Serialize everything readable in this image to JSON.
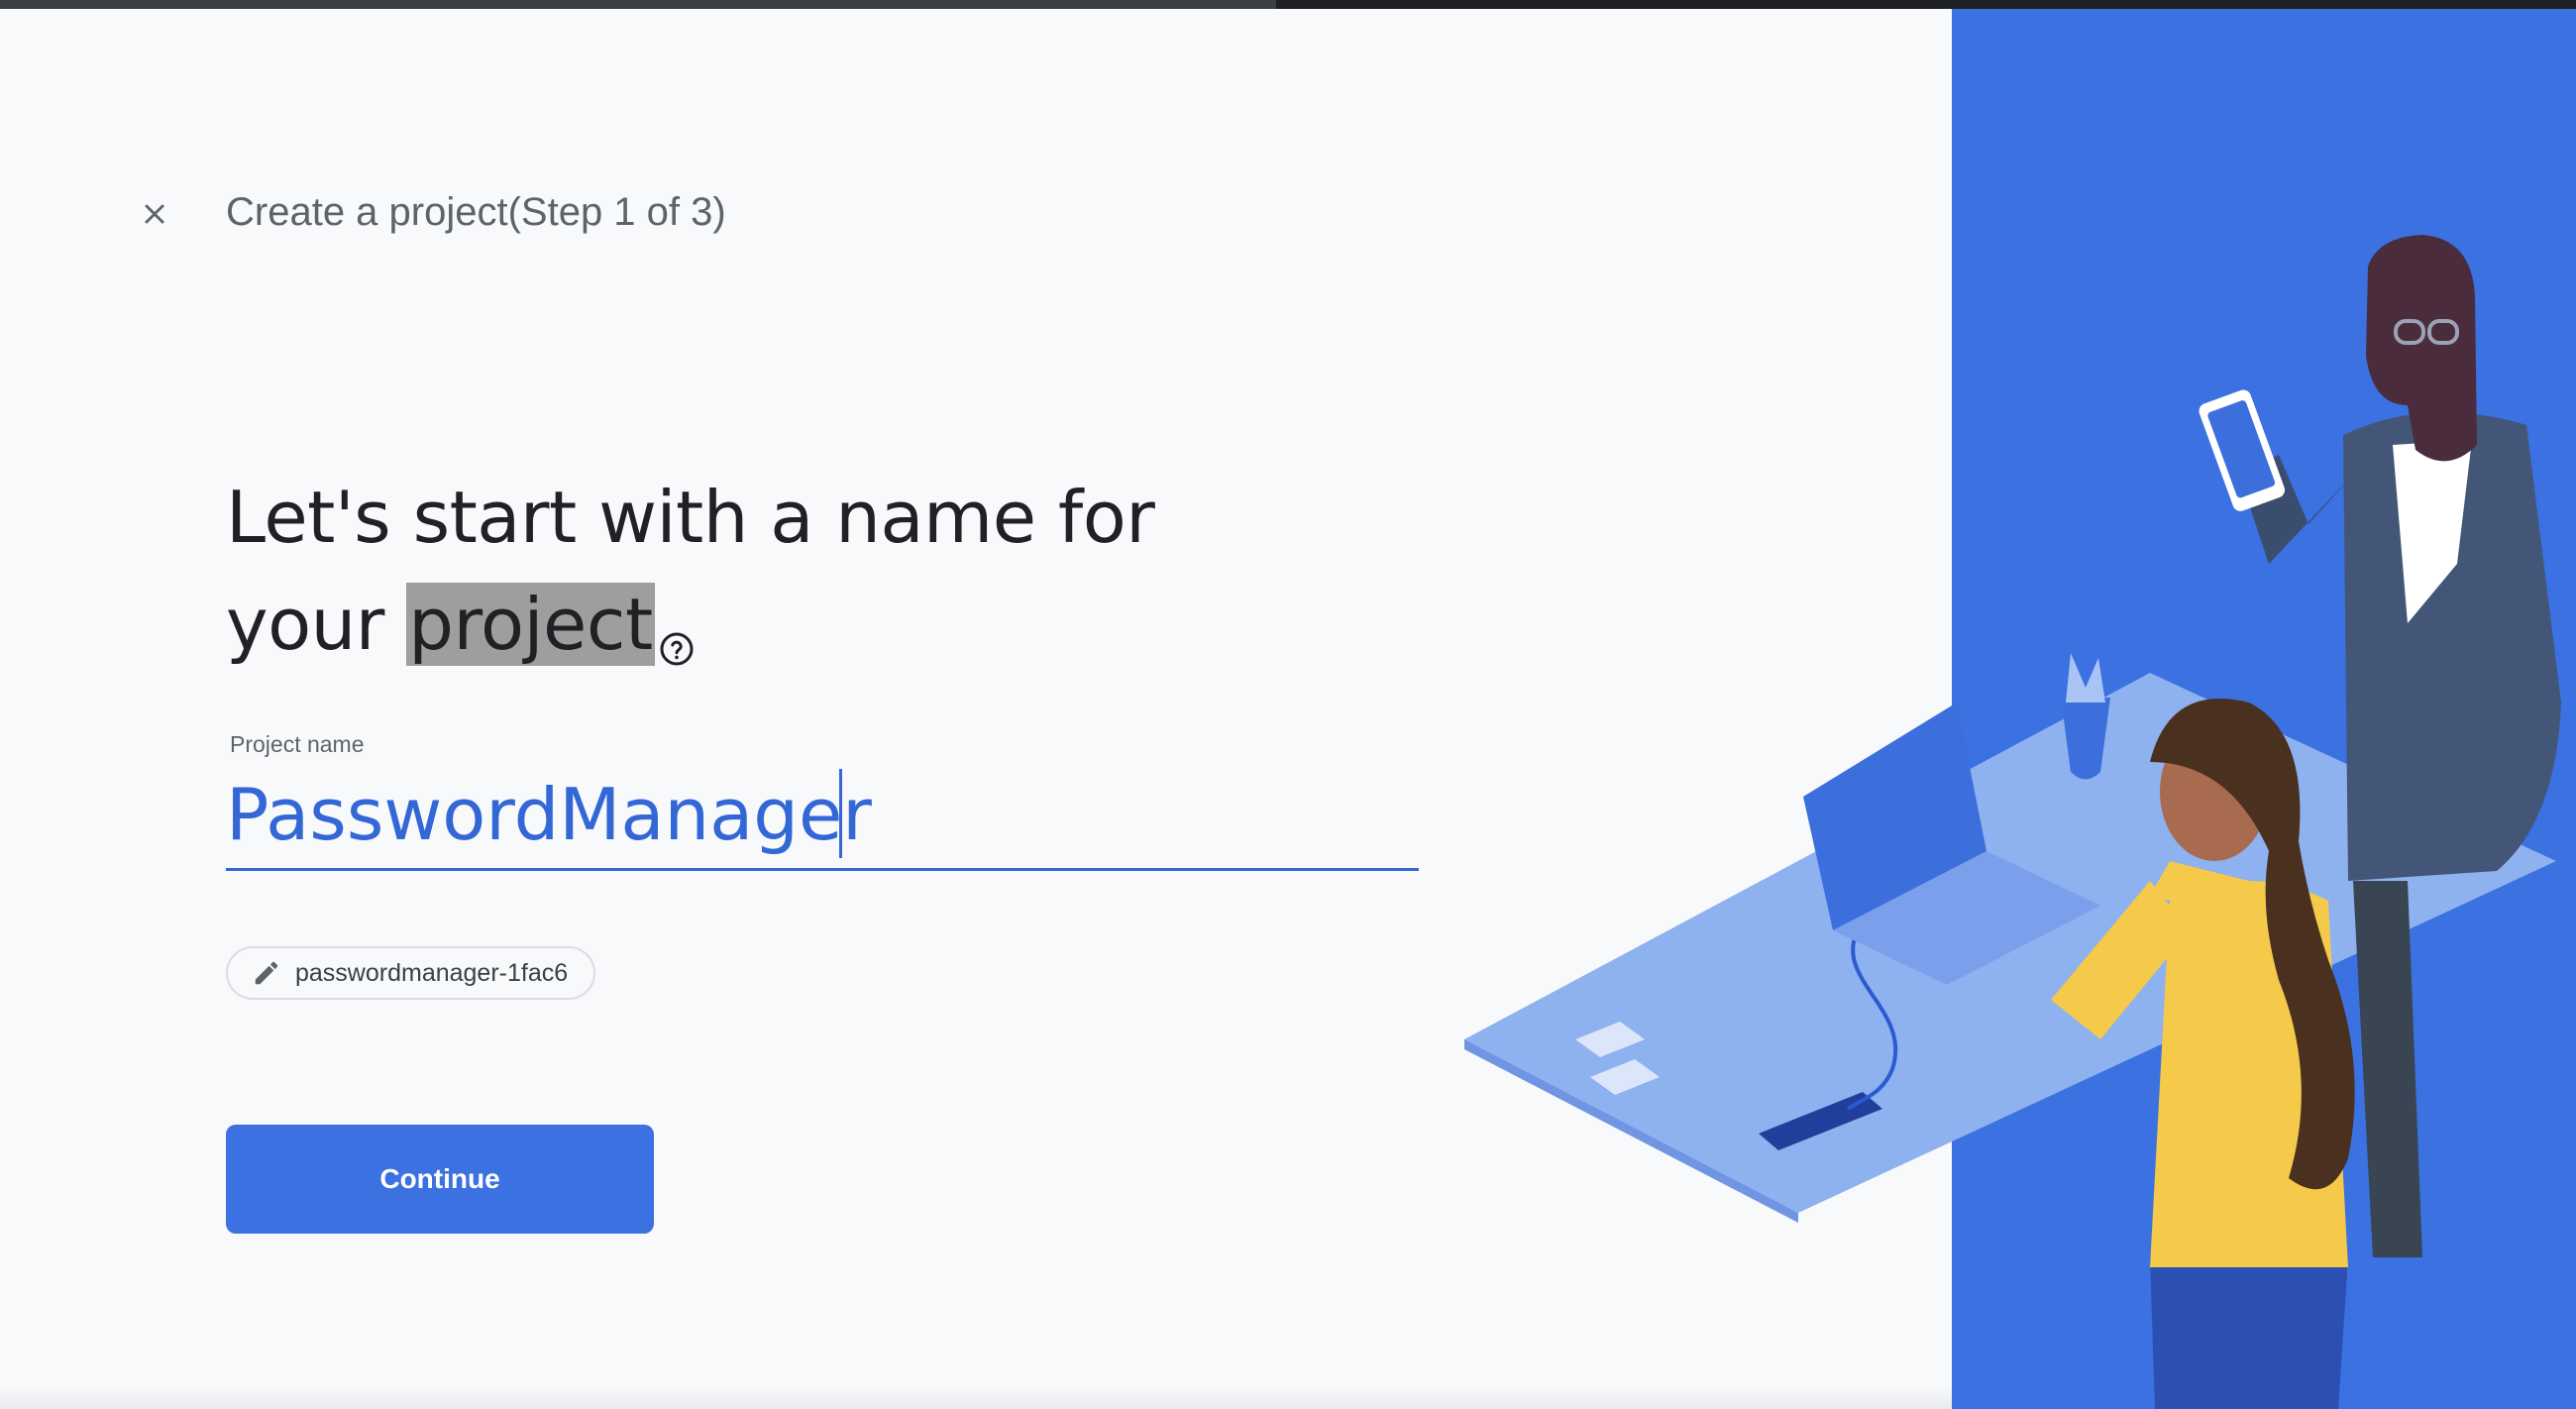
{
  "header": {
    "close_icon": "close-icon",
    "step_title": "Create a project(Step 1 of 3)"
  },
  "headline": {
    "line1": "Let's start with a name for",
    "line2_prefix": "your ",
    "line2_highlight": "project",
    "help_icon": "help-circle-icon"
  },
  "form": {
    "label": "Project name",
    "value": "PasswordManager",
    "project_id": "passwordmanager-1fac6",
    "edit_icon": "pencil-icon"
  },
  "actions": {
    "continue_label": "Continue"
  },
  "colors": {
    "accent": "#3b71e0",
    "input_text": "#3367d6",
    "background": "#f8f9fa"
  }
}
